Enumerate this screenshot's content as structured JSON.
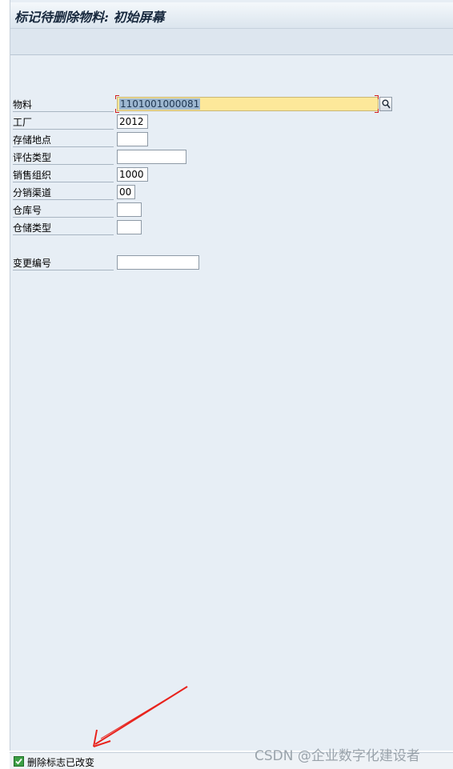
{
  "window": {
    "title": "标记待删除物料: 初始屏幕"
  },
  "form": {
    "fields": [
      {
        "label": "物料",
        "value": "1101001000081",
        "required": true
      },
      {
        "label": "工厂",
        "value": "2012"
      },
      {
        "label": "存储地点",
        "value": ""
      },
      {
        "label": "评估类型",
        "value": ""
      },
      {
        "label": "销售组织",
        "value": "1000"
      },
      {
        "label": "分销渠道",
        "value": "00"
      },
      {
        "label": "仓库号",
        "value": ""
      },
      {
        "label": "仓储类型",
        "value": ""
      },
      {
        "label": "变更编号",
        "value": ""
      }
    ]
  },
  "status": {
    "message": "删除标志已改变",
    "icon": "checkmark-icon"
  },
  "watermark": "CSDN @企业数字化建设者",
  "colors": {
    "required_field": "#fde89a",
    "annotation_arrow": "#e8231d",
    "status_ok": "#3d9f45"
  }
}
